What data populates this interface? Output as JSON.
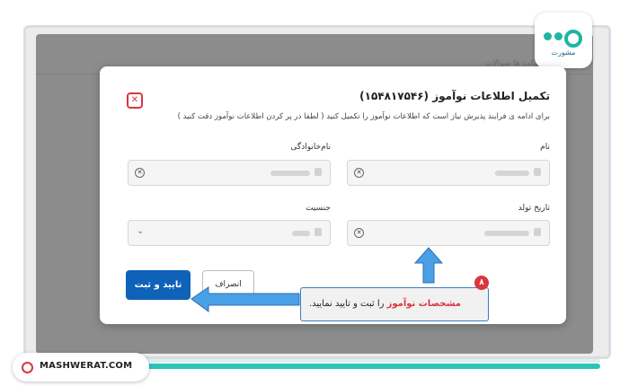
{
  "background": {
    "tabs": "تیکت ها    سوالات"
  },
  "logo": {
    "text": "مشورت"
  },
  "modal": {
    "title": "تکمیل اطلاعات نوآموز (۱۵۴۸۱۷۵۴۶)",
    "description": "برای ادامه ی فرایند پذیرش نیاز است که اطلاعات نوآموز را تکمیل کنید ( لطفا در پر کردن اطلاعات نوآموز دقت کنید )",
    "fields": {
      "first_name_label": "نام",
      "last_name_label": "نام‌خانوادگی",
      "birth_date_label": "تاریخ تولد",
      "gender_label": "جنسیت"
    },
    "cancel_label": "انصراف",
    "confirm_label": "تایید و ثبت"
  },
  "annotation": {
    "step": "۸",
    "highlight": "مشخصات نوآموز",
    "rest": " را ثبت و تایید نمایید."
  },
  "footer": {
    "site": "MASHWERAT.COM"
  },
  "colors": {
    "accent": "#2fc3b6",
    "primary_button": "#0e62b8",
    "danger": "#d9363e",
    "arrow": "#3d8fd8"
  }
}
